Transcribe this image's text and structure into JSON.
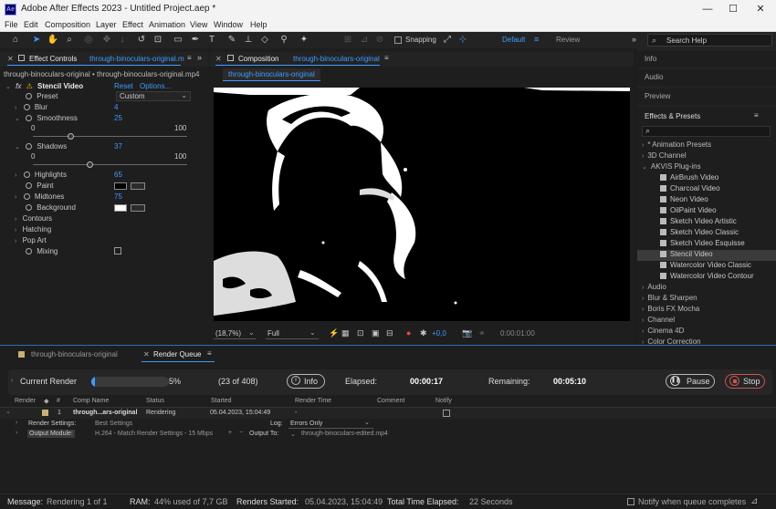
{
  "window": {
    "title": "Adobe After Effects 2023 - Untitled Project.aep *",
    "app_badge": "Ae",
    "minimize": "—",
    "maximize": "☐",
    "close": "✕"
  },
  "menu": [
    "File",
    "Edit",
    "Composition",
    "Layer",
    "Effect",
    "Animation",
    "View",
    "Window",
    "Help"
  ],
  "toolbar": {
    "snapping_label": "Snapping",
    "workspace_default": "Default",
    "workspace_review": "Review",
    "search_placeholder": "Search Help"
  },
  "effect_controls": {
    "tab_label": "Effect Controls",
    "tab_file": "through-binoculars-original.m",
    "header": "through-binoculars-original • through-binoculars-original.mp4",
    "effect_name": "Stencil Video",
    "reset": "Reset",
    "options": "Options...",
    "preset_label": "Preset",
    "preset_value": "Custom",
    "blur_label": "Blur",
    "blur_value": "4",
    "smoothness_label": "Smoothness",
    "smoothness_value": "25",
    "smoothness_min": "0",
    "smoothness_max": "100",
    "smoothness_level": 0.25,
    "shadows_label": "Shadows",
    "shadows_value": "37",
    "shadows_min": "0",
    "shadows_max": "100",
    "shadows_level": 0.37,
    "highlights_label": "Highlights",
    "highlights_value": "65",
    "paint_label": "Paint",
    "paint_color": "#000000",
    "midtones_label": "Midtones",
    "midtones_value": "75",
    "background_label": "Background",
    "background_color": "#ffffff",
    "contours_label": "Contours",
    "hatching_label": "Hatching",
    "pop_art_label": "Pop Art",
    "mixing_label": "Mixing"
  },
  "composition": {
    "tab_label": "Composition",
    "tab_name": "through-binoculars-original",
    "subtab": "through-binoculars-original",
    "zoom": "(18,7%)",
    "resolution": "Full",
    "exposure": "+0,0",
    "timecode": "0:00:01:00"
  },
  "right_panels": {
    "info": "Info",
    "audio": "Audio",
    "preview": "Preview",
    "effects_presets": "Effects & Presets",
    "search_placeholder": "",
    "tree": [
      {
        "label": "* Animation Presets",
        "level": 0,
        "expanded": false
      },
      {
        "label": "3D Channel",
        "level": 0,
        "expanded": false
      },
      {
        "label": "AKVIS Plug-ins",
        "level": 0,
        "expanded": true
      },
      {
        "label": "AirBrush Video",
        "level": 1
      },
      {
        "label": "Charcoal Video",
        "level": 1
      },
      {
        "label": "Neon Video",
        "level": 1
      },
      {
        "label": "OilPaint Video",
        "level": 1
      },
      {
        "label": "Sketch Video Artistic",
        "level": 1
      },
      {
        "label": "Sketch Video Classic",
        "level": 1
      },
      {
        "label": "Sketch Video Esquisse",
        "level": 1
      },
      {
        "label": "Stencil Video",
        "level": 1,
        "selected": true
      },
      {
        "label": "Watercolor Video Classic",
        "level": 1
      },
      {
        "label": "Watercolor Video Contour",
        "level": 1
      },
      {
        "label": "Audio",
        "level": 0,
        "expanded": false
      },
      {
        "label": "Blur & Sharpen",
        "level": 0,
        "expanded": false
      },
      {
        "label": "Boris FX Mocha",
        "level": 0,
        "expanded": false
      },
      {
        "label": "Channel",
        "level": 0,
        "expanded": false
      },
      {
        "label": "Cinema 4D",
        "level": 0,
        "expanded": false
      },
      {
        "label": "Color Correction",
        "level": 0,
        "expanded": false
      }
    ]
  },
  "render_queue": {
    "timeline_tab": "through-binoculars-original",
    "tab_label": "Render Queue",
    "current_render_label": "Current Render",
    "progress_percent": "5%",
    "progress": 0.05,
    "frames": "(23 of 408)",
    "info_button": "Info",
    "elapsed_label": "Elapsed:",
    "elapsed_value": "00:00:17",
    "remaining_label": "Remaining:",
    "remaining_value": "00:05:10",
    "pause": "Pause",
    "stop": "Stop",
    "columns": [
      "Render",
      "#",
      "Comp Name",
      "Status",
      "Started",
      "Render Time",
      "Comment",
      "Notify"
    ],
    "item": {
      "number": "1",
      "comp_name": "through...ars-original",
      "status": "Rendering",
      "started": "05.04.2023, 15:04:49",
      "render_time": "-"
    },
    "render_settings_label": "Render Settings:",
    "render_settings_value": "Best Settings",
    "log_label": "Log:",
    "log_value": "Errors Only",
    "output_module_label": "Output Module:",
    "output_module_value": "H.264 - Match Render Settings - 15 Mbps",
    "output_to_label": "Output To:",
    "output_to_value": "through-binoculars-edited.mp4"
  },
  "statusbar": {
    "message_label": "Message:",
    "message_value": "Rendering 1 of 1",
    "ram_label": "RAM:",
    "ram_value": "44% used of 7,7 GB",
    "renders_started_label": "Renders Started:",
    "renders_started_value": "05.04.2023, 15:04:49",
    "total_time_label": "Total Time Elapsed:",
    "total_time_value": "22 Seconds",
    "notify_label": "Notify when queue completes"
  },
  "colors": {
    "accent_blue": "#3d9bff",
    "panel_bg": "#1e1e1e",
    "selected_item": "#3b3b3b"
  }
}
